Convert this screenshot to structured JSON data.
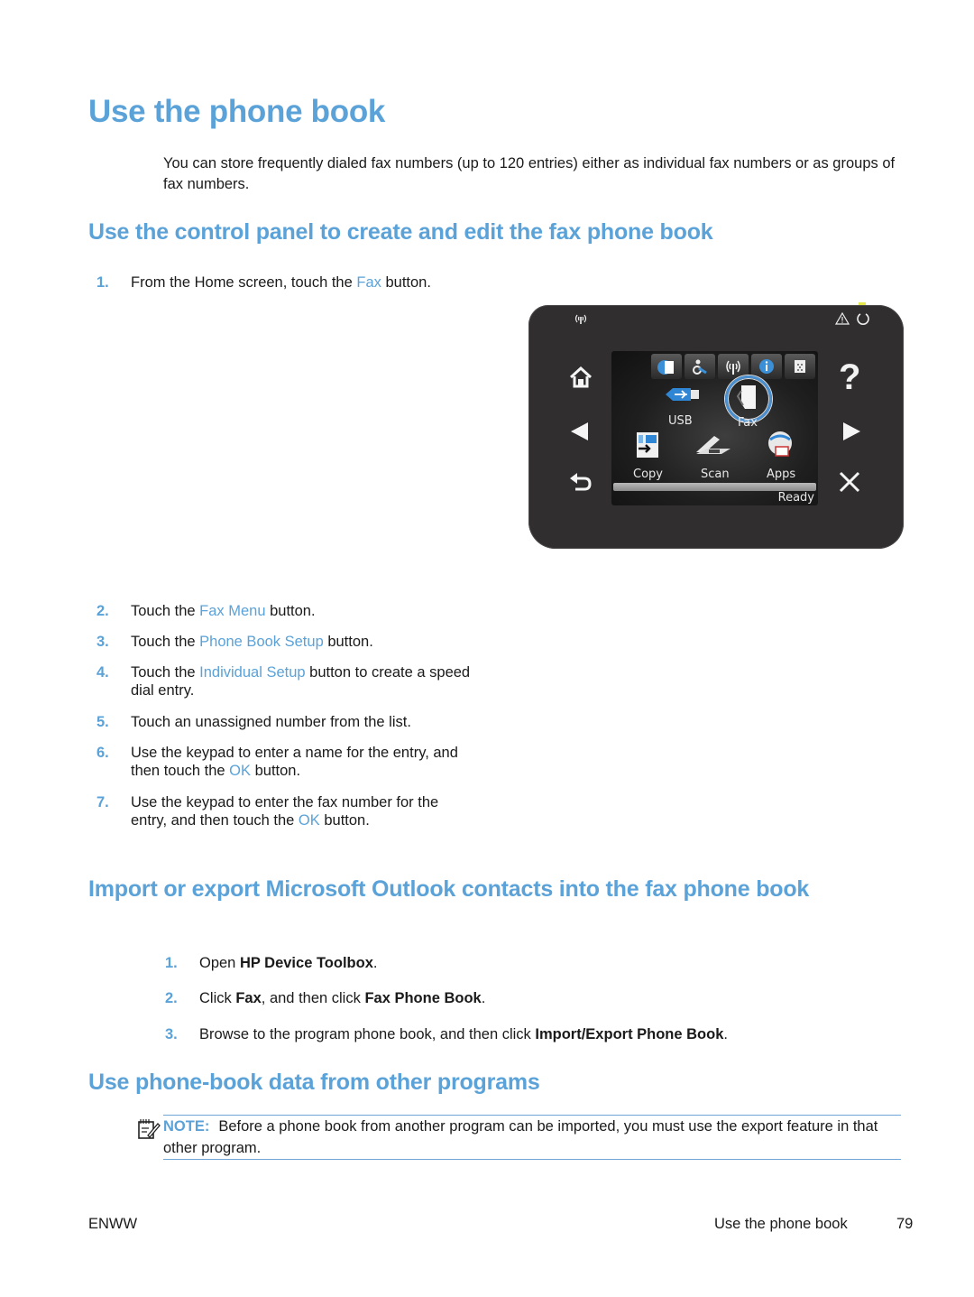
{
  "page": {
    "title": "Use the phone book",
    "intro": "You can store frequently dialed fax numbers (up to 120 entries) either as individual fax numbers or as groups of fax numbers."
  },
  "section_control_panel": {
    "heading": "Use the control panel to create and edit the fax phone book",
    "steps": [
      {
        "num": "1.",
        "pre": "From the Home screen, touch the ",
        "link": "Fax",
        "post": " button."
      },
      {
        "num": "2.",
        "pre": "Touch the ",
        "link": "Fax Menu",
        "post": " button."
      },
      {
        "num": "3.",
        "pre": "Touch the ",
        "link": "Phone Book Setup",
        "post": " button."
      },
      {
        "num": "4.",
        "pre": "Touch the ",
        "link": "Individual Setup",
        "post": " button to create a speed dial entry."
      },
      {
        "num": "5.",
        "pre": "Touch an unassigned number from the list.",
        "link": "",
        "post": ""
      },
      {
        "num": "6.",
        "pre": "Use the keypad to enter a name for the entry, and then touch the ",
        "link": "OK",
        "post": " button."
      },
      {
        "num": "7.",
        "pre": "Use the keypad to enter the fax number for the entry, and then touch the ",
        "link": "OK",
        "post": " button."
      }
    ]
  },
  "control_panel_image": {
    "screen_apps": [
      "USB",
      "Fax",
      "Copy",
      "Scan",
      "Apps"
    ],
    "highlighted_app": "Fax",
    "status": "Ready",
    "top_tab_icons": [
      "paper-icon",
      "setup-tools-icon",
      "wireless-icon",
      "info-icon",
      "supplies-icon"
    ],
    "left_buttons": [
      "home-icon",
      "left-arrow-icon",
      "back-icon"
    ],
    "right_buttons": [
      "help-icon",
      "right-arrow-icon",
      "cancel-icon"
    ],
    "top_indicators": [
      "wireless-indicator-icon",
      "attention-icon",
      "power-icon"
    ],
    "help_glyph": "?",
    "led_color": "#e3e74a"
  },
  "section_outlook": {
    "heading": "Import or export Microsoft Outlook contacts into the fax phone book",
    "steps": [
      {
        "num": "1.",
        "parts": [
          {
            "t": "Open "
          },
          {
            "t": "HP Device Toolbox",
            "b": true
          },
          {
            "t": "."
          }
        ]
      },
      {
        "num": "2.",
        "parts": [
          {
            "t": "Click "
          },
          {
            "t": "Fax",
            "b": true
          },
          {
            "t": ", and then click "
          },
          {
            "t": "Fax Phone Book",
            "b": true
          },
          {
            "t": "."
          }
        ]
      },
      {
        "num": "3.",
        "parts": [
          {
            "t": "Browse to the program phone book, and then click "
          },
          {
            "t": "Import/Export Phone Book",
            "b": true
          },
          {
            "t": "."
          }
        ]
      }
    ]
  },
  "section_other_programs": {
    "heading": "Use phone-book data from other programs",
    "note_label": "NOTE:",
    "note_text": "Before a phone book from another program can be imported, you must use the export feature in that other program."
  },
  "footer": {
    "left": "ENWW",
    "title": "Use the phone book",
    "page_number": "79"
  },
  "colors": {
    "accent": "#5aa2d8",
    "panel_bg": "#302e2f",
    "text": "#1a1a1a"
  }
}
